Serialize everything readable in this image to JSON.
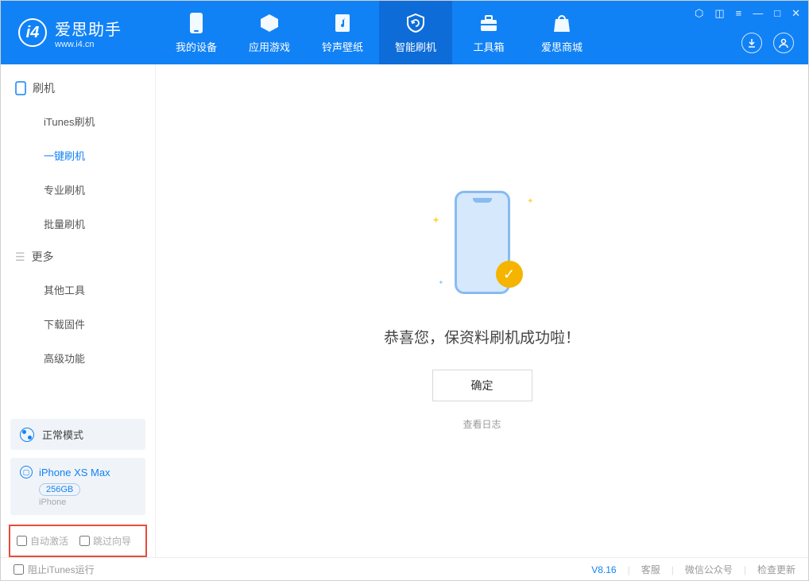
{
  "app": {
    "name": "爱思助手",
    "domain": "www.i4.cn"
  },
  "tabs": {
    "device": "我的设备",
    "apps": "应用游戏",
    "ring": "铃声壁纸",
    "flash": "智能刷机",
    "tools": "工具箱",
    "store": "爱思商城"
  },
  "sidebar": {
    "group1": "刷机",
    "items1": {
      "itunes": "iTunes刷机",
      "oneclick": "一键刷机",
      "pro": "专业刷机",
      "batch": "批量刷机"
    },
    "group2": "更多",
    "items2": {
      "other": "其他工具",
      "fw": "下载固件",
      "adv": "高级功能"
    }
  },
  "device": {
    "mode": "正常模式",
    "name": "iPhone XS Max",
    "storage": "256GB",
    "type": "iPhone"
  },
  "options": {
    "auto_activate": "自动激活",
    "skip_guide": "跳过向导"
  },
  "main": {
    "success": "恭喜您，保资料刷机成功啦！",
    "ok": "确定",
    "view_log": "查看日志"
  },
  "footer": {
    "block_itunes": "阻止iTunes运行",
    "version": "V8.16",
    "service": "客服",
    "wechat": "微信公众号",
    "update": "检查更新"
  }
}
